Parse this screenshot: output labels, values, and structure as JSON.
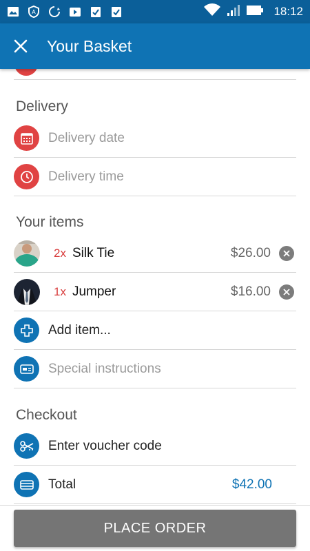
{
  "status_bar": {
    "time": "18:12"
  },
  "app_bar": {
    "title": "Your Basket",
    "close_icon": "close-icon"
  },
  "delivery": {
    "title": "Delivery",
    "date_placeholder": "Delivery date",
    "time_placeholder": "Delivery time"
  },
  "items": {
    "title": "Your items",
    "list": [
      {
        "qty": "2x",
        "name": "Silk Tie",
        "price": "$26.00",
        "avatar_color": "#2aa58a"
      },
      {
        "qty": "1x",
        "name": "Jumper",
        "price": "$16.00",
        "avatar_color": "#1d2433"
      }
    ],
    "add_label": "Add item...",
    "special_instructions_placeholder": "Special instructions"
  },
  "checkout": {
    "title": "Checkout",
    "voucher_label": "Enter voucher code",
    "total_label": "Total",
    "total_value": "$42.00"
  },
  "place_order_label": "PLACE ORDER",
  "colors": {
    "primary": "#0f73b4",
    "status_bar": "#0b5f99",
    "accent_red": "#e04343",
    "button_gray": "#757575"
  }
}
